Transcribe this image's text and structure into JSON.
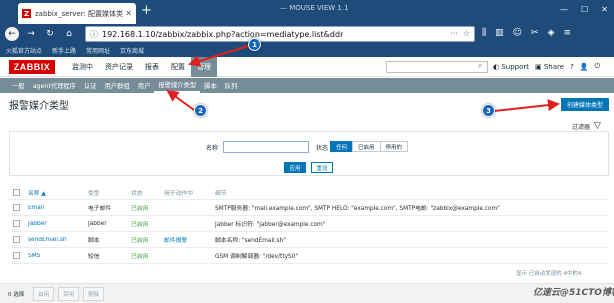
{
  "browser": {
    "tab_title": "zabbix_server: 配置媒体类型",
    "tab_favicon": "Z",
    "window_title": "— MOUSE VIEW 1.1",
    "url": "192.168.1.10/zabbix/zabbix.php?action=mediatype.list&ddr",
    "bookmarks": [
      "火狐官方站点",
      "新手上路",
      "常用网址",
      "京东商城"
    ]
  },
  "header": {
    "logo": "ZABBIX",
    "menu": [
      "监测中",
      "资产记录",
      "报表",
      "配置",
      "管理"
    ],
    "active_menu": "管理",
    "support": "Support",
    "share": "Share"
  },
  "submenu": {
    "items": [
      "一般",
      "agent代理程序",
      "认证",
      "用户群组",
      "用户",
      "报警媒介类型",
      "脚本",
      "队列"
    ],
    "active": "报警媒介类型"
  },
  "page": {
    "title": "报警媒介类型",
    "create_button": "创建媒体类型",
    "filter_tab": "过滤器"
  },
  "filter": {
    "name_label": "名称",
    "status_label": "状态",
    "status_options": [
      "任何",
      "已启用",
      "停用的"
    ],
    "status_selected": "任何",
    "apply": "应用",
    "reset": "重设"
  },
  "table": {
    "headers": [
      "名称 ▲",
      "类型",
      "状态",
      "用于动作中",
      "细节"
    ],
    "rows": [
      {
        "name": "Email",
        "type": "电子邮件",
        "status": "已启用",
        "used_in": "",
        "details": "SMTP服务器: \"mail.example.com\", SMTP HELO: \"example.com\", SMTP电邮: \"zabbix@example.com\""
      },
      {
        "name": "Jabber",
        "type": "Jabber",
        "status": "已启用",
        "used_in": "",
        "details": "Jabber 标识符: \"jabber@example.com\""
      },
      {
        "name": "sendEmail.sh",
        "type": "脚本",
        "status": "已启用",
        "used_in": "邮件报警",
        "details": "脚本名称: \"sendEmail.sh\""
      },
      {
        "name": "SMS",
        "type": "短信",
        "status": "已启用",
        "used_in": "",
        "details": "GSM 调制解调器: \"/dev/ttyS0\""
      }
    ],
    "footer": "显示 已自动发现的 4中的4"
  },
  "bottom": {
    "selected": "0 选择",
    "actions": [
      "启用",
      "禁用",
      "删除"
    ]
  },
  "watermark": "亿速云@51CTO博客",
  "badges": [
    "1",
    "2",
    "3"
  ],
  "colors": {
    "browser_chrome": "#1e4b7a",
    "zabbix_red": "#d40000",
    "submenu_bg": "#768d99",
    "primary_blue": "#0275b8",
    "enabled_green": "#429e47",
    "annotation_red": "#e0201e"
  }
}
